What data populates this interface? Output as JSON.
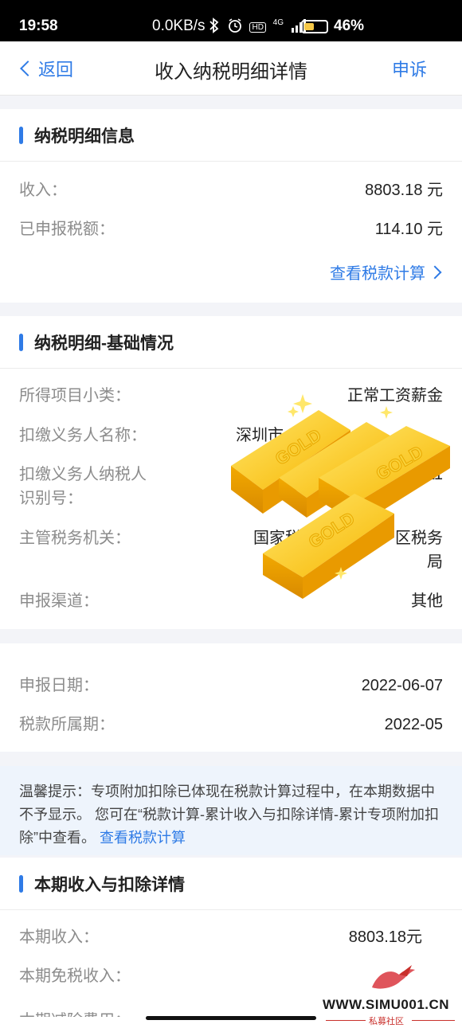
{
  "status_bar": {
    "time": "19:58",
    "network_speed": "0.0KB/s",
    "icons": [
      "bluetooth-icon",
      "alarm-icon",
      "hd-icon",
      "signal-4g-icon",
      "battery-icon"
    ],
    "signal_label": "4G",
    "hd_label": "HD",
    "battery_percent": "46%",
    "battery_level": 0.46
  },
  "nav": {
    "back_label": "返回",
    "title": "收入纳税明细详情",
    "appeal_label": "申诉"
  },
  "section_tax_info": {
    "title": "纳税明细信息",
    "rows": [
      {
        "label": "收入：",
        "value": "8803.18 元"
      },
      {
        "label": "已申报税额：",
        "value": "114.10 元"
      }
    ],
    "link_label": "查看税款计算"
  },
  "section_basic": {
    "title": "纳税明细-基础情况",
    "rows": [
      {
        "label": "所得项目小类：",
        "value": "正常工资薪金"
      },
      {
        "label": "扣缴义务人名称：",
        "value": "深圳市"
      },
      {
        "label": "扣缴义务人纳税人识别号：",
        "label_line1": "扣缴义务人纳税人",
        "label_line2": "识别号：",
        "value": "511"
      },
      {
        "label": "主管税务机关：",
        "value_line1": "国家税务总局",
        "value_line1_tail": "区税务",
        "value_line2": "局"
      },
      {
        "label": "申报渠道：",
        "value": "其他"
      }
    ]
  },
  "section_dates": {
    "rows": [
      {
        "label": "申报日期：",
        "value": "2022-06-07"
      },
      {
        "label": "税款所属期：",
        "value": "2022-05"
      }
    ]
  },
  "tip": {
    "text": "温馨提示：专项附加扣除已体现在税款计算过程中，在本期数据中不予显示。 您可在“税款计算-累计收入与扣除详情-累计专项附加扣除”中查看。",
    "link_label": "查看税款计算"
  },
  "section_current": {
    "title": "本期收入与扣除详情",
    "rows": [
      {
        "label": "本期收入：",
        "value": "8803.18元"
      },
      {
        "label": "本期免税收入：",
        "value": ""
      },
      {
        "label": "本期减除费用：",
        "value": ""
      }
    ]
  },
  "sticker": {
    "bar_text": "GOLD",
    "color": "#f7b500"
  },
  "watermark": {
    "text": "WWW.SIMU001.CN",
    "sub": "私募社区"
  },
  "colors": {
    "accent": "#2f7be6",
    "label": "#8c8c8c",
    "tip_bg": "#eef4fc"
  }
}
